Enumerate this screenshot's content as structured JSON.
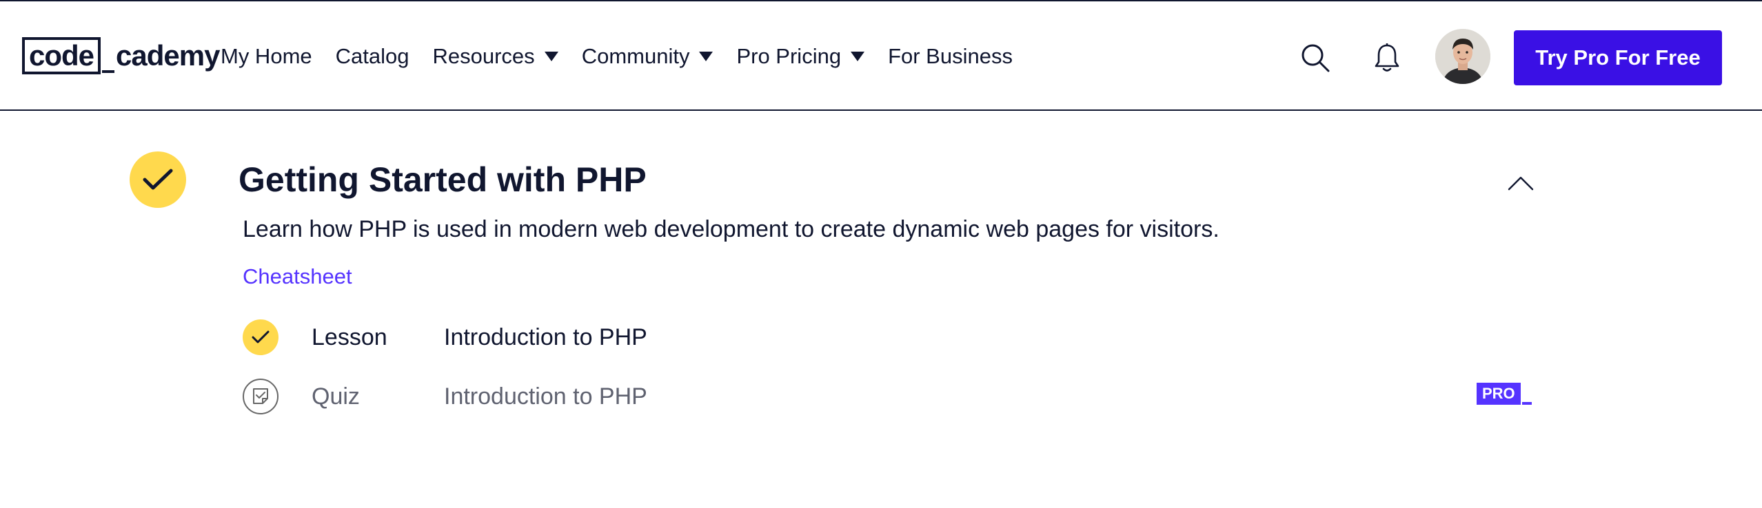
{
  "header": {
    "logo": {
      "boxed": "code",
      "rest": "cademy"
    },
    "nav": [
      {
        "label": "My Home",
        "has_dropdown": false
      },
      {
        "label": "Catalog",
        "has_dropdown": false
      },
      {
        "label": "Resources",
        "has_dropdown": true
      },
      {
        "label": "Community",
        "has_dropdown": true
      },
      {
        "label": "Pro Pricing",
        "has_dropdown": true
      },
      {
        "label": "For Business",
        "has_dropdown": false
      }
    ],
    "icons": {
      "search": "search-icon",
      "notifications": "bell-icon"
    },
    "cta_label": "Try Pro For Free",
    "colors": {
      "cta": "#3a10e5",
      "text": "#10162f"
    }
  },
  "module": {
    "title": "Getting Started with PHP",
    "completed": true,
    "description": "Learn how PHP is used in modern web development to create dynamic web pages for visitors.",
    "cheatsheet_label": "Cheatsheet",
    "items": [
      {
        "type": "Lesson",
        "name": "Introduction to PHP",
        "status": "completed",
        "pro": false
      },
      {
        "type": "Quiz",
        "name": "Introduction to PHP",
        "status": "not-started",
        "pro": true,
        "pro_label": "PRO"
      }
    ],
    "colors": {
      "check": "#ffd94d",
      "link": "#5533ff",
      "pro": "#5533ff"
    }
  }
}
